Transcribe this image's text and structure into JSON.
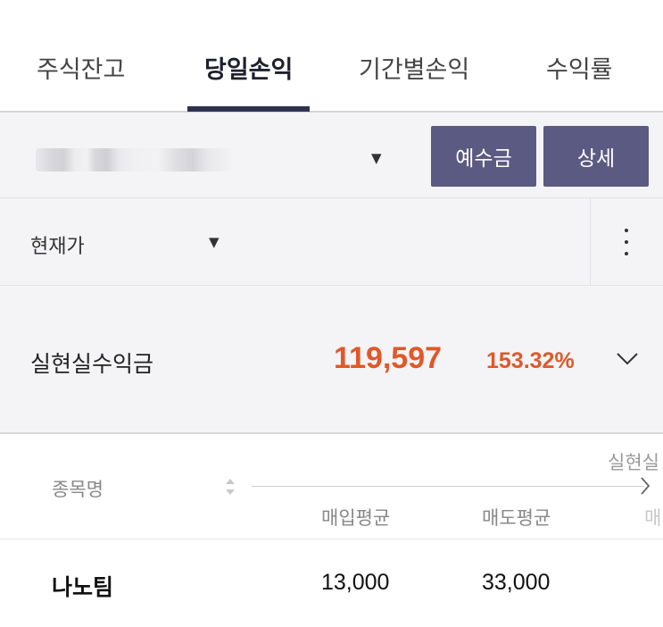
{
  "tabs": [
    {
      "label": "주식잔고",
      "active": false
    },
    {
      "label": "당일손익",
      "active": true
    },
    {
      "label": "기간별손익",
      "active": false
    },
    {
      "label": "수익률",
      "active": false
    }
  ],
  "account": {
    "dropdown_icon": "caret-down-icon",
    "deposit_button": "예수금",
    "detail_button": "상세"
  },
  "price_selector": {
    "label": "현재가",
    "dropdown_icon": "caret-down-icon",
    "more_icon": "more-vertical-icon"
  },
  "realized_profit": {
    "label": "실현실수익금",
    "amount": "119,597",
    "rate": "153.32%",
    "expand_icon": "chevron-down-icon",
    "color": "#e0582a"
  },
  "table": {
    "col_name": "종목명",
    "col_realized_partial": "실현실",
    "col_buy_avg": "매입평균",
    "col_sell_avg": "매도평균",
    "col_partial": "매",
    "rows": [
      {
        "name": "나노팀",
        "buy_avg": "13,000",
        "sell_avg": "33,000"
      }
    ]
  },
  "colors": {
    "accent": "#5b5a82",
    "tab_indicator": "#2e3150",
    "profit": "#e0582a"
  }
}
